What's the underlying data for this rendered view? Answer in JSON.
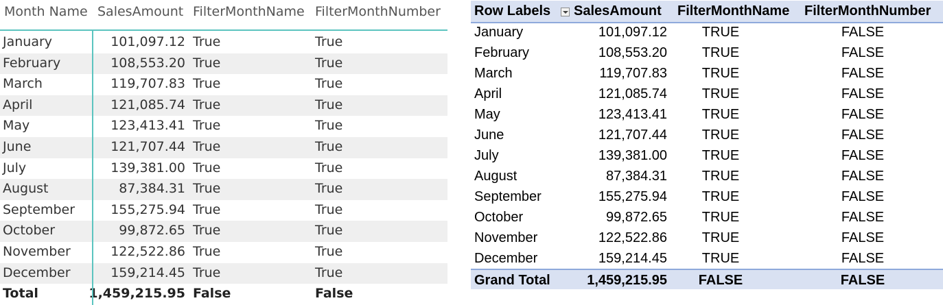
{
  "powerbi_table": {
    "headers": [
      "Month Name",
      "SalesAmount",
      "FilterMonthName",
      "FilterMonthNumber"
    ],
    "rows": [
      {
        "month": "January",
        "sales": "101,097.12",
        "fname": "True",
        "fnum": "True"
      },
      {
        "month": "February",
        "sales": "108,553.20",
        "fname": "True",
        "fnum": "True"
      },
      {
        "month": "March",
        "sales": "119,707.83",
        "fname": "True",
        "fnum": "True"
      },
      {
        "month": "April",
        "sales": "121,085.74",
        "fname": "True",
        "fnum": "True"
      },
      {
        "month": "May",
        "sales": "123,413.41",
        "fname": "True",
        "fnum": "True"
      },
      {
        "month": "June",
        "sales": "121,707.44",
        "fname": "True",
        "fnum": "True"
      },
      {
        "month": "July",
        "sales": "139,381.00",
        "fname": "True",
        "fnum": "True"
      },
      {
        "month": "August",
        "sales": "87,384.31",
        "fname": "True",
        "fnum": "True"
      },
      {
        "month": "September",
        "sales": "155,275.94",
        "fname": "True",
        "fnum": "True"
      },
      {
        "month": "October",
        "sales": "99,872.65",
        "fname": "True",
        "fnum": "True"
      },
      {
        "month": "November",
        "sales": "122,522.86",
        "fname": "True",
        "fnum": "True"
      },
      {
        "month": "December",
        "sales": "159,214.45",
        "fname": "True",
        "fnum": "True"
      }
    ],
    "total": {
      "month": "Total",
      "sales": "1,459,215.95",
      "fname": "False",
      "fnum": "False"
    },
    "accent_color": "#5bc4bf"
  },
  "excel_pivot": {
    "headers": [
      "Row Labels",
      "SalesAmount",
      "FilterMonthName",
      "FilterMonthNumber"
    ],
    "rows": [
      {
        "month": "January",
        "sales": "101,097.12",
        "fname": "TRUE",
        "fnum": "FALSE"
      },
      {
        "month": "February",
        "sales": "108,553.20",
        "fname": "TRUE",
        "fnum": "FALSE"
      },
      {
        "month": "March",
        "sales": "119,707.83",
        "fname": "TRUE",
        "fnum": "FALSE"
      },
      {
        "month": "April",
        "sales": "121,085.74",
        "fname": "TRUE",
        "fnum": "FALSE"
      },
      {
        "month": "May",
        "sales": "123,413.41",
        "fname": "TRUE",
        "fnum": "FALSE"
      },
      {
        "month": "June",
        "sales": "121,707.44",
        "fname": "TRUE",
        "fnum": "FALSE"
      },
      {
        "month": "July",
        "sales": "139,381.00",
        "fname": "TRUE",
        "fnum": "FALSE"
      },
      {
        "month": "August",
        "sales": "87,384.31",
        "fname": "TRUE",
        "fnum": "FALSE"
      },
      {
        "month": "September",
        "sales": "155,275.94",
        "fname": "TRUE",
        "fnum": "FALSE"
      },
      {
        "month": "October",
        "sales": "99,872.65",
        "fname": "TRUE",
        "fnum": "FALSE"
      },
      {
        "month": "November",
        "sales": "122,522.86",
        "fname": "TRUE",
        "fnum": "FALSE"
      },
      {
        "month": "December",
        "sales": "159,214.45",
        "fname": "TRUE",
        "fnum": "FALSE"
      }
    ],
    "total": {
      "month": "Grand Total",
      "sales": "1,459,215.95",
      "fname": "FALSE",
      "fnum": "FALSE"
    },
    "header_color": "#d9e1f2",
    "filter_icon": "dropdown-filter-icon"
  }
}
